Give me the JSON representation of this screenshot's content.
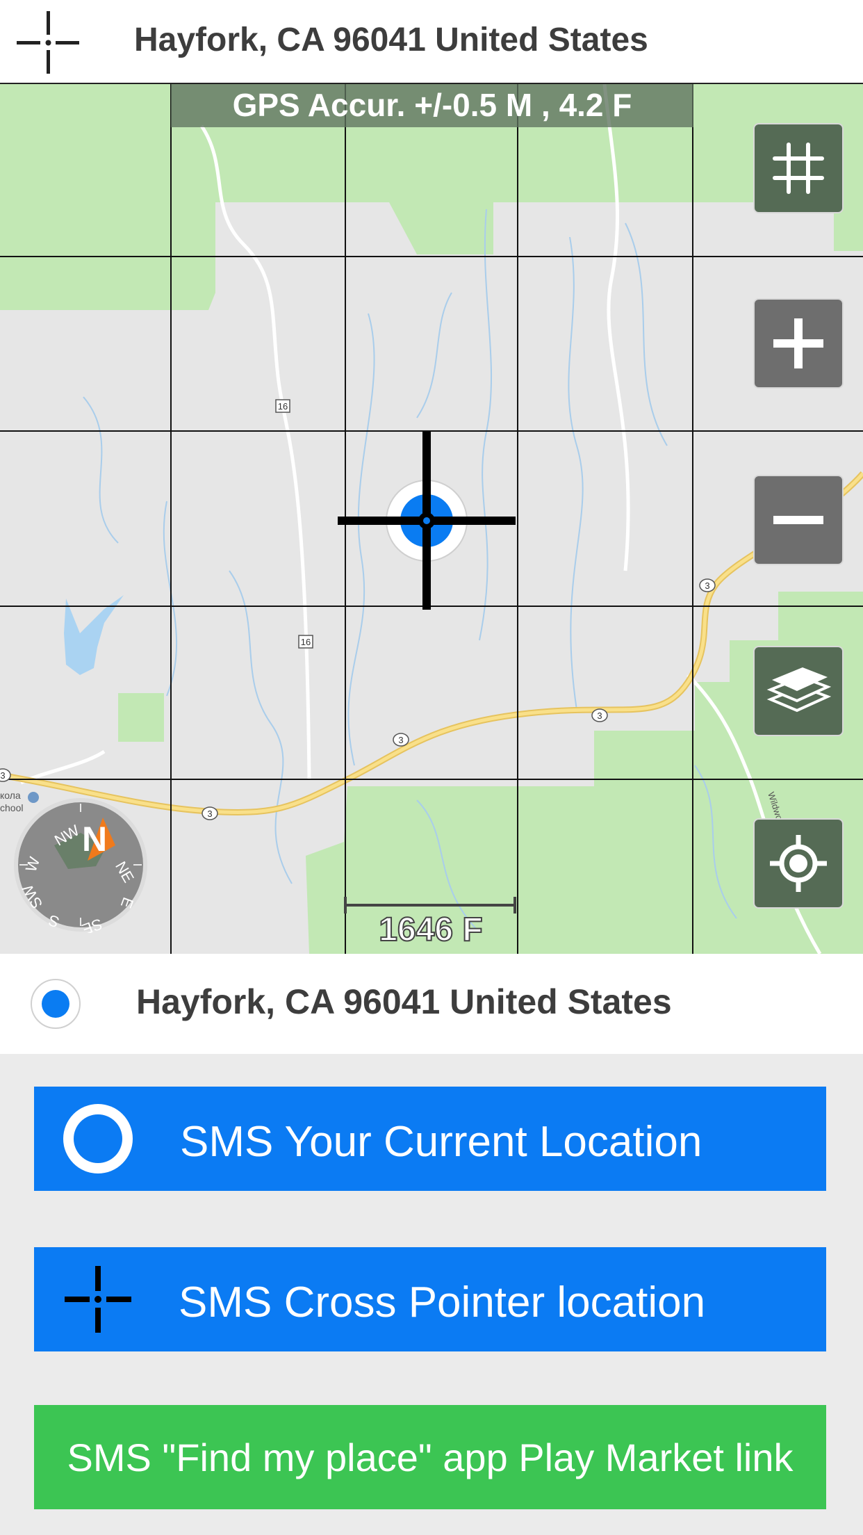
{
  "header": {
    "title": "Hayfork, CA 96041 United States"
  },
  "map": {
    "gps_accuracy": "GPS Accur. +/-0.5 M , 4.2 F",
    "scale_label": "1646 F",
    "compass_labels": [
      "N",
      "NE",
      "E",
      "SE",
      "S",
      "SW",
      "W",
      "NW"
    ],
    "road_labels": [
      "16",
      "16",
      "3",
      "3",
      "3",
      "3",
      "3",
      "3"
    ],
    "place_label": "кола\nchool",
    "road_name": "Wildwood Rd",
    "buttons": [
      {
        "name": "grid-toggle-button",
        "icon": "grid-icon"
      },
      {
        "name": "zoom-in-button",
        "icon": "plus-icon"
      },
      {
        "name": "zoom-out-button",
        "icon": "minus-icon"
      },
      {
        "name": "layers-button",
        "icon": "layers-icon"
      },
      {
        "name": "my-location-button",
        "icon": "target-icon"
      }
    ],
    "colors": {
      "land": "#e6e6e6",
      "forest": "#c2e8b4",
      "water": "#aad3f2",
      "road": "#f5d56b",
      "accent": "#0a7cf2"
    }
  },
  "address": {
    "text": "Hayfork, CA 96041 United States"
  },
  "actions": {
    "sms_current": "SMS Your Current Location",
    "sms_cross": "SMS Cross Pointer location",
    "sms_app": "SMS \"Find my place\" app Play Market link"
  }
}
